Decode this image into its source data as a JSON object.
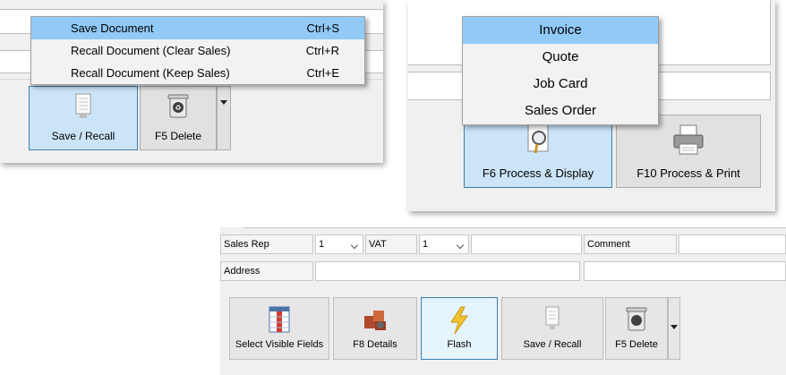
{
  "panel_top_left": {
    "menu_items": [
      {
        "label": "Save Document",
        "shortcut": "Ctrl+S",
        "selected": true
      },
      {
        "label": "Recall Document (Clear Sales)",
        "shortcut": "Ctrl+R",
        "selected": false
      },
      {
        "label": "Recall Document (Keep Sales)",
        "shortcut": "Ctrl+E",
        "selected": false
      }
    ],
    "buttons": {
      "save_recall": "Save / Recall",
      "delete": "F5 Delete"
    }
  },
  "panel_top_right": {
    "menu_items": [
      {
        "label": "Invoice",
        "selected": true
      },
      {
        "label": "Quote",
        "selected": false
      },
      {
        "label": "Job Card",
        "selected": false
      },
      {
        "label": "Sales Order",
        "selected": false
      }
    ],
    "buttons": {
      "process_display": "F6 Process & Display",
      "process_print": "F10 Process & Print"
    }
  },
  "panel_bottom": {
    "fields": {
      "sales_rep_label": "Sales Rep",
      "sales_rep_value": "1",
      "vat_label": "VAT",
      "vat_value": "1",
      "comment_label": "Comment",
      "address_label": "Address"
    },
    "buttons": {
      "select_visible_fields": "Select Visible Fields",
      "details": "F8 Details",
      "flash": "Flash",
      "save_recall": "Save / Recall",
      "delete": "F5 Delete"
    }
  },
  "colors": {
    "menu_highlight": "#91c9f7",
    "button_hot": "#cce4f7",
    "window_bg": "#f0f0f0"
  },
  "icons": [
    "document-save-icon",
    "recycle-bin-icon",
    "magnifier-document-icon",
    "printer-icon",
    "columns-icon",
    "boxes-icon",
    "lightning-icon"
  ]
}
